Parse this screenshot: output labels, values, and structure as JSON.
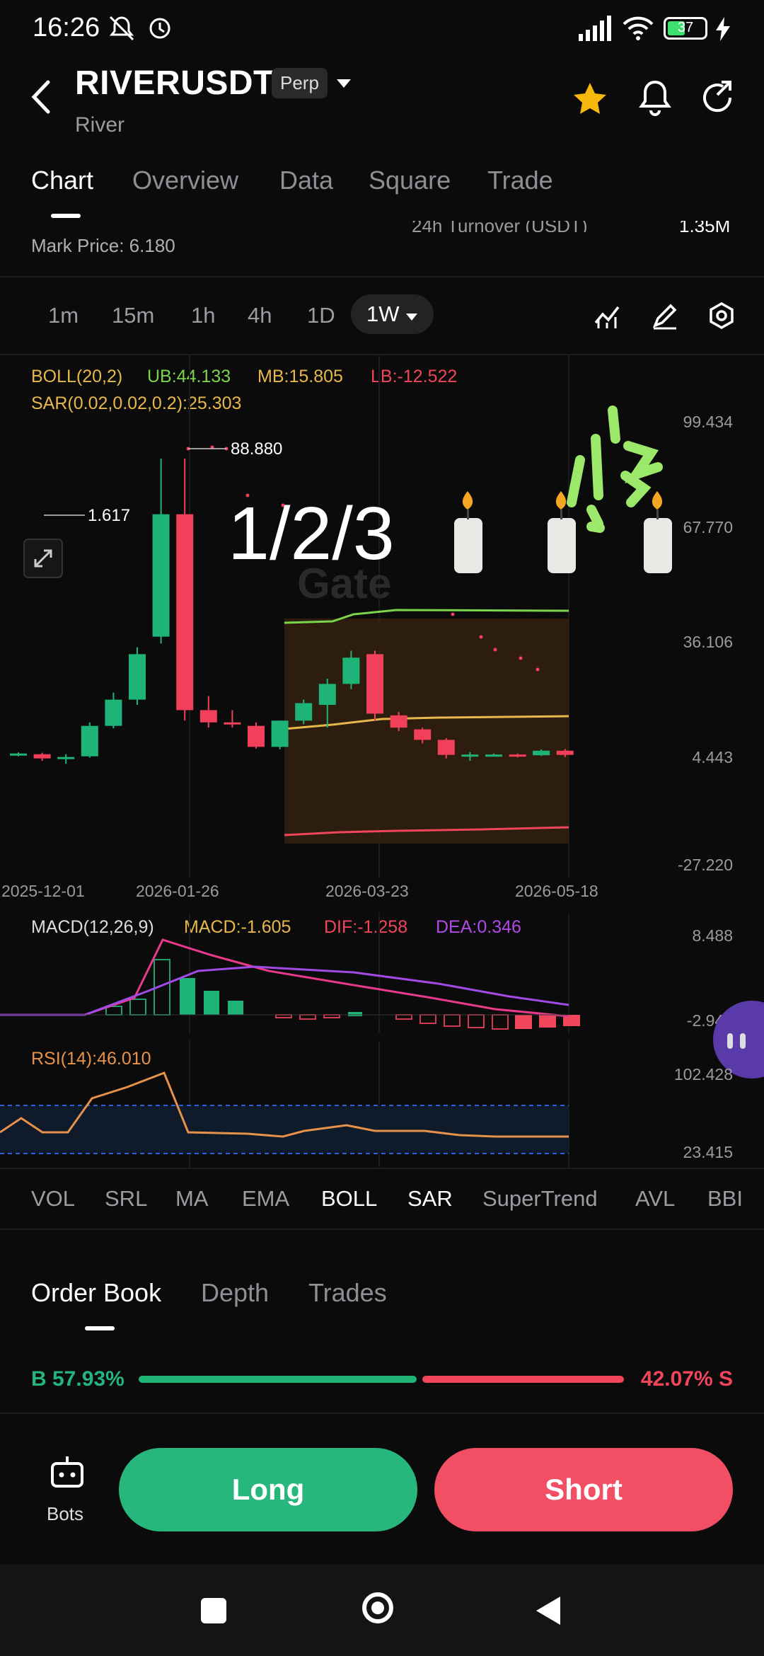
{
  "status_bar": {
    "time": "16:26",
    "battery": "37"
  },
  "header": {
    "symbol": "RIVERUSDT",
    "badge": "Perp",
    "name": "River"
  },
  "tabs": [
    "Chart",
    "Overview",
    "Data",
    "Square",
    "Trade"
  ],
  "stats": {
    "mark_price": "Mark Price: 6.180",
    "turnover_label": "24h   Turnover (USDT)",
    "turnover_value": "1.35M"
  },
  "intervals": [
    "1m",
    "15m",
    "1h",
    "4h",
    "1D",
    "1W"
  ],
  "main_chart": {
    "boll_name": "BOLL(20,2)",
    "boll_ub": "UB:44.133",
    "boll_mb": "MB:15.805",
    "boll_lb": "LB:-12.522",
    "sar": "SAR(0.02,0.02,0.2):25.303",
    "y_ticks": [
      "99.434",
      "67.770",
      "36.106",
      "4.443",
      "-27.220"
    ],
    "x_ticks": [
      "2025-12-01",
      "2026-01-26",
      "2026-03-23",
      "2026-05-18"
    ],
    "high_label": "88.880",
    "low_label": "1.617",
    "overlay_text": "1/2/3",
    "watermark": "Gate"
  },
  "macd": {
    "name": "MACD(12,26,9)",
    "macd": "MACD:-1.605",
    "dif": "DIF:-1.258",
    "dea": "DEA:0.346",
    "y_ticks": [
      "8.488",
      "-2.940"
    ]
  },
  "rsi": {
    "name": "RSI(14):46.010",
    "y_ticks": [
      "102.428",
      "23.415"
    ]
  },
  "indicators": [
    "VOL",
    "SRL",
    "MA",
    "EMA",
    "BOLL",
    "SAR",
    "SuperTrend",
    "AVL",
    "BBI"
  ],
  "order_book_tabs": [
    "Order Book",
    "Depth",
    "Trades"
  ],
  "ratio": {
    "buy": "B 57.93%",
    "sell": "42.07% S",
    "buy_pct": 57.93
  },
  "actions": {
    "bots": "Bots",
    "long": "Long",
    "short": "Short"
  },
  "chart_data": {
    "type": "candlestick",
    "x_ticks": [
      "2025-12-01",
      "2026-01-26",
      "2026-03-23",
      "2026-05-18"
    ],
    "ylim": [
      -27.22,
      99.434
    ],
    "candles": [
      {
        "o": 4.2,
        "h": 4.9,
        "l": 3.8,
        "c": 4.6
      },
      {
        "o": 4.4,
        "h": 4.8,
        "l": 2.5,
        "c": 3.2
      },
      {
        "o": 3.0,
        "h": 4.4,
        "l": 1.617,
        "c": 3.6
      },
      {
        "o": 3.8,
        "h": 13.5,
        "l": 3.4,
        "c": 12.5
      },
      {
        "o": 12.5,
        "h": 22.0,
        "l": 11.8,
        "c": 20.0
      },
      {
        "o": 20.0,
        "h": 35.0,
        "l": 18.5,
        "c": 33.0
      },
      {
        "o": 38.0,
        "h": 88.88,
        "l": 36.0,
        "c": 73.0
      },
      {
        "o": 73.0,
        "h": 88.88,
        "l": 14.0,
        "c": 17.0
      },
      {
        "o": 17.0,
        "h": 21.0,
        "l": 12.0,
        "c": 13.5
      },
      {
        "o": 13.5,
        "h": 17.0,
        "l": 12.0,
        "c": 13.0
      },
      {
        "o": 12.5,
        "h": 13.5,
        "l": 6.0,
        "c": 6.5
      },
      {
        "o": 6.5,
        "h": 14.0,
        "l": 5.8,
        "c": 14.0
      },
      {
        "o": 14.0,
        "h": 20.0,
        "l": 13.0,
        "c": 19.0
      },
      {
        "o": 18.5,
        "h": 26.0,
        "l": 12.0,
        "c": 24.5
      },
      {
        "o": 24.5,
        "h": 34.0,
        "l": 23.0,
        "c": 32.0
      },
      {
        "o": 33.0,
        "h": 34.0,
        "l": 14.0,
        "c": 16.0
      },
      {
        "o": 15.5,
        "h": 16.5,
        "l": 11.0,
        "c": 12.0
      },
      {
        "o": 11.5,
        "h": 12.0,
        "l": 7.5,
        "c": 8.5
      },
      {
        "o": 8.5,
        "h": 9.0,
        "l": 3.2,
        "c": 4.2
      },
      {
        "o": 4.0,
        "h": 5.0,
        "l": 2.5,
        "c": 4.3
      },
      {
        "o": 4.2,
        "h": 4.6,
        "l": 3.8,
        "c": 4.3
      },
      {
        "o": 4.3,
        "h": 4.6,
        "l": 3.5,
        "c": 4.2
      },
      {
        "o": 4.1,
        "h": 5.8,
        "l": 3.9,
        "c": 5.4
      },
      {
        "o": 5.4,
        "h": 5.9,
        "l": 3.6,
        "c": 4.2
      }
    ]
  }
}
